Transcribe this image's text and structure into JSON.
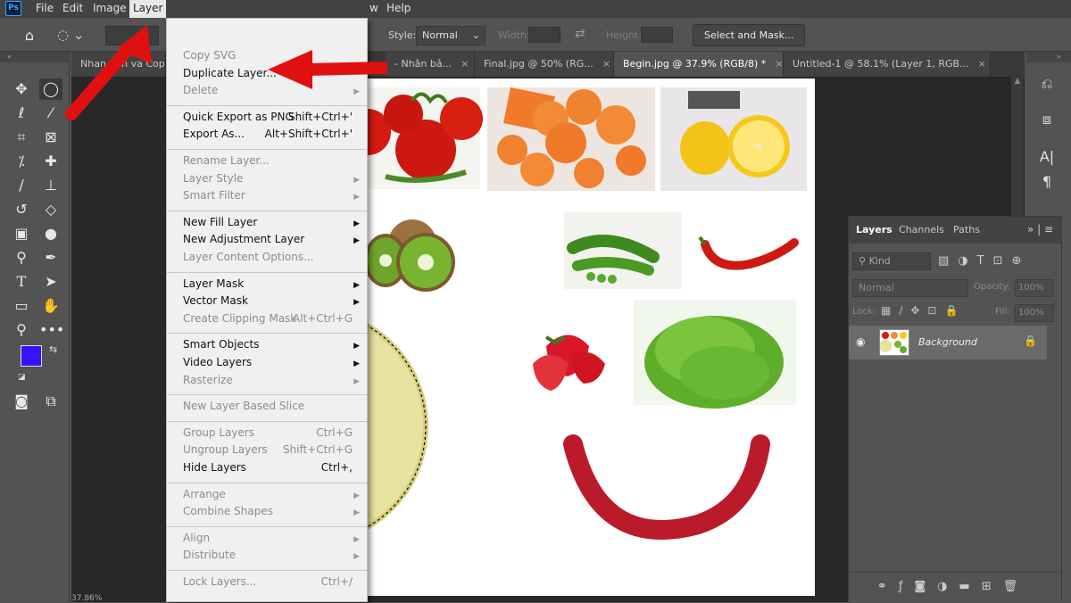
{
  "app": {
    "logo": "Ps"
  },
  "menubar": {
    "items": [
      "File",
      "Edit",
      "Image",
      "Layer",
      "w",
      "Help"
    ]
  },
  "options": {
    "style_label": "Style:",
    "style_value": "Normal",
    "width_label": "Width:",
    "height_label": "Height:",
    "select_mask": "Select and Mask..."
  },
  "tabs": [
    "Nhan ban va Copy",
    "- Nhân bả...",
    "Final.jpg @ 50% (RG...",
    "Begin.jpg @ 37.9% (RGB/8) *",
    "Untitled-1 @ 58.1% (Layer 1, RGB..."
  ],
  "colors": {
    "foreground": "#3a10ff",
    "background": "#ffffff",
    "accent_arrow": "#e11010"
  },
  "layer_menu": [
    {
      "label": "Copy SVG",
      "enabled": false
    },
    {
      "label": "Duplicate Layer...",
      "enabled": true
    },
    {
      "label": "Delete",
      "enabled": false,
      "submenu": true
    },
    {
      "separator": true
    },
    {
      "label": "Quick Export as PNG",
      "shortcut": "Shift+Ctrl+'",
      "enabled": true
    },
    {
      "label": "Export As...",
      "shortcut": "Alt+Shift+Ctrl+'",
      "enabled": true
    },
    {
      "separator": true
    },
    {
      "label": "Rename Layer...",
      "enabled": false
    },
    {
      "label": "Layer Style",
      "enabled": false,
      "submenu": true
    },
    {
      "label": "Smart Filter",
      "enabled": false,
      "submenu": true
    },
    {
      "separator": true
    },
    {
      "label": "New Fill Layer",
      "enabled": true,
      "submenu": true
    },
    {
      "label": "New Adjustment Layer",
      "enabled": true,
      "submenu": true
    },
    {
      "label": "Layer Content Options...",
      "enabled": false
    },
    {
      "separator": true
    },
    {
      "label": "Layer Mask",
      "enabled": true,
      "submenu": true
    },
    {
      "label": "Vector Mask",
      "enabled": true,
      "submenu": true
    },
    {
      "label": "Create Clipping Mask",
      "shortcut": "Alt+Ctrl+G",
      "enabled": false
    },
    {
      "separator": true
    },
    {
      "label": "Smart Objects",
      "enabled": true,
      "submenu": true
    },
    {
      "label": "Video Layers",
      "enabled": true,
      "submenu": true
    },
    {
      "label": "Rasterize",
      "enabled": false,
      "submenu": true
    },
    {
      "separator": true
    },
    {
      "label": "New Layer Based Slice",
      "enabled": false
    },
    {
      "separator": true
    },
    {
      "label": "Group Layers",
      "shortcut": "Ctrl+G",
      "enabled": false
    },
    {
      "label": "Ungroup Layers",
      "shortcut": "Shift+Ctrl+G",
      "enabled": false
    },
    {
      "label": "Hide Layers",
      "shortcut": "Ctrl+,",
      "enabled": true
    },
    {
      "separator": true
    },
    {
      "label": "Arrange",
      "enabled": false,
      "submenu": true
    },
    {
      "label": "Combine Shapes",
      "enabled": false,
      "submenu": true
    },
    {
      "separator": true
    },
    {
      "label": "Align",
      "enabled": false,
      "submenu": true
    },
    {
      "label": "Distribute",
      "enabled": false,
      "submenu": true
    },
    {
      "separator": true
    },
    {
      "label": "Lock Layers...",
      "shortcut": "Ctrl+/",
      "enabled": false
    }
  ],
  "layers_panel": {
    "tabs": [
      "Layers",
      "Channels",
      "Paths"
    ],
    "filter_kind": "Kind",
    "blend_mode": "Normal",
    "opacity_label": "Opacity:",
    "opacity_value": "100%",
    "lock_label": "Lock:",
    "fill_label": "Fill:",
    "fill_value": "100%",
    "layer_name": "Background"
  },
  "status": {
    "zoom": "37.86%"
  }
}
